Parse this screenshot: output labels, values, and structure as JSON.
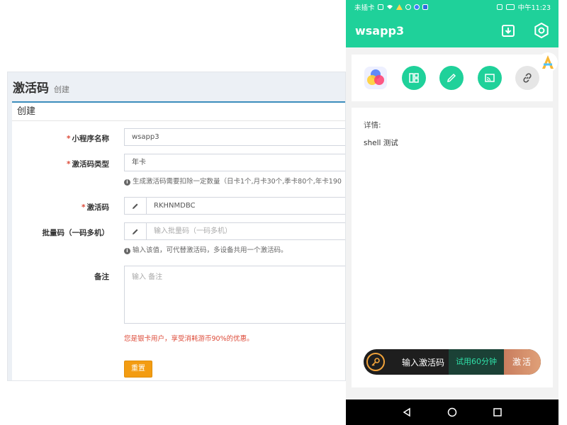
{
  "admin": {
    "title": "激活码",
    "subtitle": "创建",
    "box_title": "创建",
    "fields": {
      "app_name": {
        "label": "小程序名称",
        "required": "*",
        "value": "wsapp3"
      },
      "code_type": {
        "label": "激活码类型",
        "required": "*",
        "value": "年卡",
        "help": "生成激活码需要扣除一定数量（日卡1个,月卡30个,季卡80个,年卡190"
      },
      "code": {
        "label": "激活码",
        "required": "*",
        "value": "RKHNMDBC"
      },
      "batch": {
        "label": "批量码（一码多机）",
        "placeholder": "输入批量码（一码多机）",
        "help": "输入该值，可代替激活码，多设备共用一个激活码。"
      },
      "remark": {
        "label": "备注",
        "placeholder": "输入 备注"
      }
    },
    "notice": "您是银卡用户，享受消耗游币90%的优惠。",
    "reset_label": "重置"
  },
  "phone": {
    "status": {
      "carrier": "未插卡",
      "time": "中午11:23"
    },
    "app_title": "wsapp3",
    "detail_label": "详情:",
    "detail_text": "shell 测试",
    "action": {
      "prompt": "输入激活码",
      "trial": "试用60分钟",
      "activate": "激活"
    }
  },
  "colors": {
    "primary_green": "#1fd19a",
    "admin_accent": "#3c8dbc",
    "warning_orange": "#f39c12",
    "danger_red": "#dd4b39"
  }
}
